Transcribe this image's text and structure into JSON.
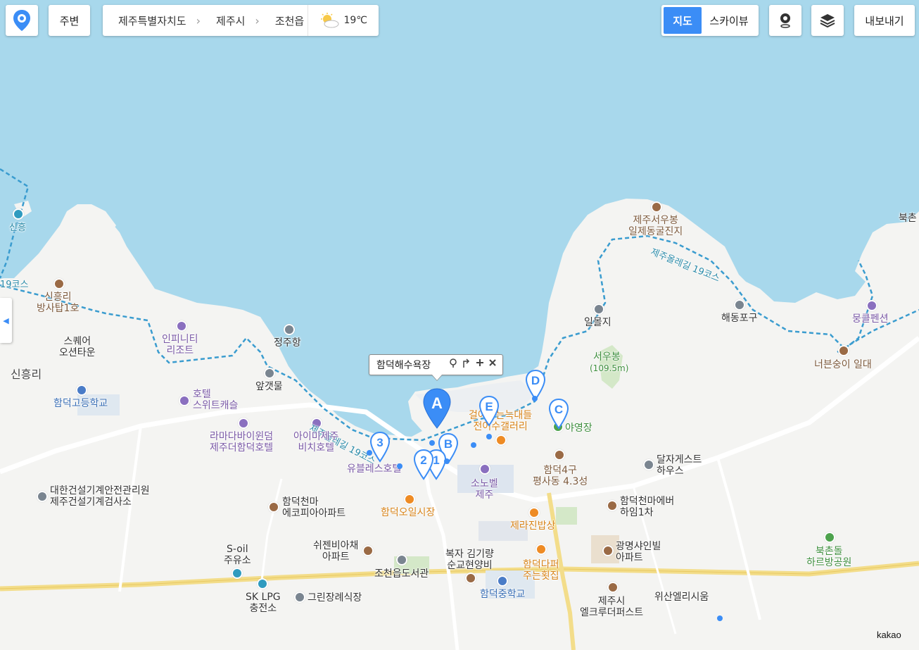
{
  "toolbar": {
    "home_icon": "map-pin-logo-icon",
    "nearby_label": "주변",
    "breadcrumb": [
      "제주특별자치도",
      "제주시",
      "조천읍"
    ],
    "weather_icon": "partly-cloudy-icon",
    "temperature": "19℃",
    "map_types": [
      {
        "label": "지도",
        "active": true
      },
      {
        "label": "스카이뷰",
        "active": false
      }
    ],
    "roadview_icon": "roadview-icon",
    "layers_icon": "layers-icon",
    "export_label": "내보내기"
  },
  "popup": {
    "title": "함덕해수욕장",
    "actions": [
      "roadview-icon",
      "directions-icon",
      "zoom-in-icon",
      "close-icon"
    ]
  },
  "markers": [
    "A",
    "B",
    "C",
    "D",
    "E",
    "1",
    "2",
    "3"
  ],
  "labels": {
    "sinheung_short": "신흥",
    "olle_left": "19코스",
    "olle_mid": "제주올레길 19코스",
    "olle_right": "제주올레길 19코스",
    "sinheung_tower": "신흥리\n방사탑1호",
    "infinity": "인피니티\n리조트",
    "jeongju": "정주항",
    "square": "스퀘어\n오션타운",
    "sinheungri": "신흥리",
    "apgat": "앞갯물",
    "hamdeok_high": "함덕고등학교",
    "hotel_suite": "호텔\n스위트캐슬",
    "ramada": "라마다바이윈덤\n제주더함덕호텔",
    "aimi": "아이미제주\n비치호텔",
    "daehan": "대한건설기계안전관리원\n제주건설기계검사소",
    "eco": "함덕천마\n에코피아아파트",
    "market": "함덕오일시장",
    "shezen": "쉬젠비아채\n아파트",
    "soil": "S-oil\n주유소",
    "sklpg": "SK LPG\n충전소",
    "green": "그린장례식장",
    "library": "조천읍도서관",
    "kim": "복자 김기량\n순교현양비",
    "hamdeok_mid": "함덕중학교",
    "sobel": "소노벨\n제주",
    "jeju_rice": "제라진밥상",
    "dapper": "함덕다퍼\n주는횟집",
    "pyeongsa": "함덕4구\n평사동 4.3성",
    "campground": "야영장",
    "gallery": "걸어가는늑대들\n전어수갤러리",
    "dalja": "달자게스트\n하우스",
    "chunma": "함덕천마에버\n하임1차",
    "gwangmyeong": "광명샤인빌\n아파트",
    "elkru": "제주시\n엘크루더퍼스트",
    "wisan": "위산엘리시움",
    "dolhareubang": "북촌돌\n하르방공원",
    "seowoo_cave": "제주서우봉\n일제동굴진지",
    "ilmolji": "일몰지",
    "seowoobong": "서우봉",
    "seowoobong_h": "(109.5m)",
    "haedong": "해동포구",
    "mungkle": "뭉클펜션",
    "neobeun": "너븐숭이 일대",
    "bukchon": "북촌",
    "ubles": "유블레스호텔",
    "hamdeok_beach_short": "함"
  },
  "attribution": "kakao"
}
